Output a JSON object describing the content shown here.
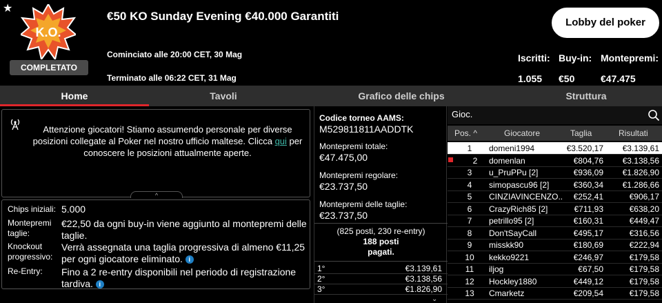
{
  "header": {
    "star_icon": "star-icon",
    "badge_text": "K.O.",
    "status": "COMPLETATO",
    "title": "€50 KO Sunday Evening €40.000 Garantiti",
    "started": "Cominciato alle 20:00 CET, 30 Mag",
    "ended": "Terminato alle 06:22 CET, 31 Mag",
    "lobby_button": "Lobby del poker",
    "stats": [
      {
        "label": "Iscritti:",
        "value": "1.055"
      },
      {
        "label": "Buy-in:",
        "value": "€50"
      },
      {
        "label": "Montepremi:",
        "value": "€47.475"
      }
    ]
  },
  "tabs": [
    "Home",
    "Tavoli",
    "Grafico delle chips",
    "Struttura"
  ],
  "notice": {
    "icon": "antenna-icon",
    "text_before": "Attenzione giocatori! Stiamo assumendo personale per diverse posizioni collegate al Poker nel nostro ufficio maltese. Clicca ",
    "link": "qui",
    "text_after": " per conoscere le posizioni attualmente aperte."
  },
  "info": [
    {
      "label": "Chips iniziali:",
      "value": "5.000"
    },
    {
      "label": "Montepremi taglie:",
      "value": "€22,50 da ogni buy-in viene aggiunto al montepremi delle taglie."
    },
    {
      "label": "Knockout progressivo:",
      "value": "Verrà assegnata una taglia progressiva di almeno €11,25 per ogni giocatore eliminato."
    },
    {
      "label": "Re-Entry:",
      "value": "Fino a 2 re-entry disponibili nel periodo di registrazione tardiva."
    }
  ],
  "middle": {
    "code_label": "Codice torneo AAMS:",
    "code_value": "M529811811AADDTK",
    "total_label": "Montepremi totale:",
    "total_value": "€47.475,00",
    "regular_label": "Montepremi regolare:",
    "regular_value": "€23.737,50",
    "bounty_label": "Montepremi delle taglie:",
    "bounty_value": "€23.737,50",
    "payout_note_1": "(825 posti, 230 re-entry)",
    "payout_note_2": "188 posti",
    "payout_note_3": "pagati.",
    "payouts": [
      {
        "place": "1°",
        "amount": "€3.139,61"
      },
      {
        "place": "2°",
        "amount": "€3.138,56"
      },
      {
        "place": "3°",
        "amount": "€1.826,90"
      }
    ]
  },
  "players": {
    "search_label": "Gioc.",
    "columns": [
      "Pos.",
      "Giocatore",
      "Taglia",
      "Risultati"
    ],
    "rows": [
      {
        "pos": "1",
        "name": "domeni1994",
        "bounty": "€3.520,17",
        "result": "€3.139,61"
      },
      {
        "pos": "2",
        "name": "domenlan",
        "bounty": "€804,76",
        "result": "€3.138,56"
      },
      {
        "pos": "3",
        "name": "u_PruPPu [2]",
        "bounty": "€936,09",
        "result": "€1.826,90"
      },
      {
        "pos": "4",
        "name": "simopascu96 [2]",
        "bounty": "€360,34",
        "result": "€1.286,66"
      },
      {
        "pos": "5",
        "name": "CINZIAVINCENZO...",
        "bounty": "€252,41",
        "result": "€906,17"
      },
      {
        "pos": "6",
        "name": "CrazyRich85 [2]",
        "bounty": "€711,93",
        "result": "€638,20"
      },
      {
        "pos": "7",
        "name": "petrillo95 [2]",
        "bounty": "€160,31",
        "result": "€449,47"
      },
      {
        "pos": "8",
        "name": "Don'tSayCall",
        "bounty": "€495,17",
        "result": "€316,56"
      },
      {
        "pos": "9",
        "name": "misskk90",
        "bounty": "€180,69",
        "result": "€222,94"
      },
      {
        "pos": "10",
        "name": "kekko9221",
        "bounty": "€246,97",
        "result": "€179,58"
      },
      {
        "pos": "11",
        "name": "iljog",
        "bounty": "€67,50",
        "result": "€179,58"
      },
      {
        "pos": "12",
        "name": "Hockley1880",
        "bounty": "€449,12",
        "result": "€179,58"
      },
      {
        "pos": "13",
        "name": "Cmarketz",
        "bounty": "€209,54",
        "result": "€179,58"
      }
    ]
  },
  "colors": {
    "accent": "#e0262b",
    "link": "#3fb8a8",
    "info_icon": "#1e7fc4"
  }
}
